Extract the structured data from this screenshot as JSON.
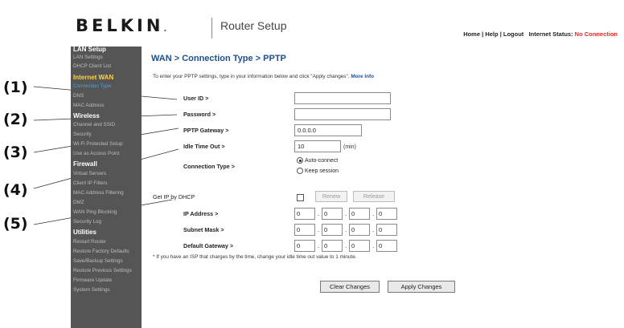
{
  "callouts": [
    "(1)",
    "(2)",
    "(3)",
    "(4)",
    "(5)"
  ],
  "header": {
    "logo": "BELKIN",
    "logo_mark": ".",
    "title": "Router Setup",
    "nav_home": "Home",
    "nav_help": "Help",
    "nav_logout": "Logout",
    "sep": "|",
    "status_label": "Internet Status:",
    "status_value": "No Connection",
    "status_color": "#e8231c"
  },
  "sidebar": {
    "lan_setup": "LAN Setup",
    "lan_settings": "LAN Settings",
    "dhcp_client_list": "DHCP Client List",
    "internet_wan": "Internet WAN",
    "connection_type": "Connection Type",
    "dns": "DNS",
    "mac_address": "MAC Address",
    "wireless": "Wireless",
    "channel_ssid": "Channel and SSID",
    "security": "Security",
    "wifi_protected": "Wi-Fi Protected Setup",
    "use_as_ap": "Use as Access Point",
    "firewall": "Firewall",
    "virtual_servers": "Virtual Servers",
    "client_ip_filters": "Client IP Filters",
    "mac_filtering": "MAC Address Filtering",
    "dmz": "DMZ",
    "wan_ping_blocking": "WAN Ping Blocking",
    "security_log": "Security Log",
    "utilities": "Utilities",
    "restart_router": "Restart Router",
    "restore_factory": "Restore Factory Defaults",
    "save_backup": "Save/Backup Settings",
    "restore_previous": "Restore Previous Settings",
    "firmware_update": "Firmware Update",
    "system_settings": "System Settings"
  },
  "main": {
    "title": "WAN > Connection Type > PPTP",
    "intro": "To enter your PPTP settings, type in your information below and click \"Apply changes\".",
    "more_info": "More Info",
    "user_id_label": "User ID >",
    "user_id_value": "",
    "password_label": "Password >",
    "password_value": "",
    "gateway_label": "PPTP Gateway >",
    "gateway_value": "0.0.0.0",
    "idle_label": "Idle Time Out >",
    "idle_value": "10",
    "idle_unit": "(min)",
    "conn_type_label": "Connection Type >",
    "auto_connect": "Auto-connect",
    "keep_session": "Keep session",
    "get_ip_label": "Get IP by DHCP",
    "renew": "Renew",
    "release": "Release",
    "ip_label": "IP Address >",
    "ip": [
      "0",
      "0",
      "0",
      "0"
    ],
    "mask_label": "Subnet Mask >",
    "mask": [
      "0",
      "0",
      "0",
      "0"
    ],
    "gw_label": "Default Gateway >",
    "gw": [
      "0",
      "0",
      "0",
      "0"
    ],
    "note": "* If you have an ISP that charges by the time, change your idle time out value to 1 minute.",
    "clear_changes": "Clear Changes",
    "apply_changes": "Apply Changes"
  }
}
